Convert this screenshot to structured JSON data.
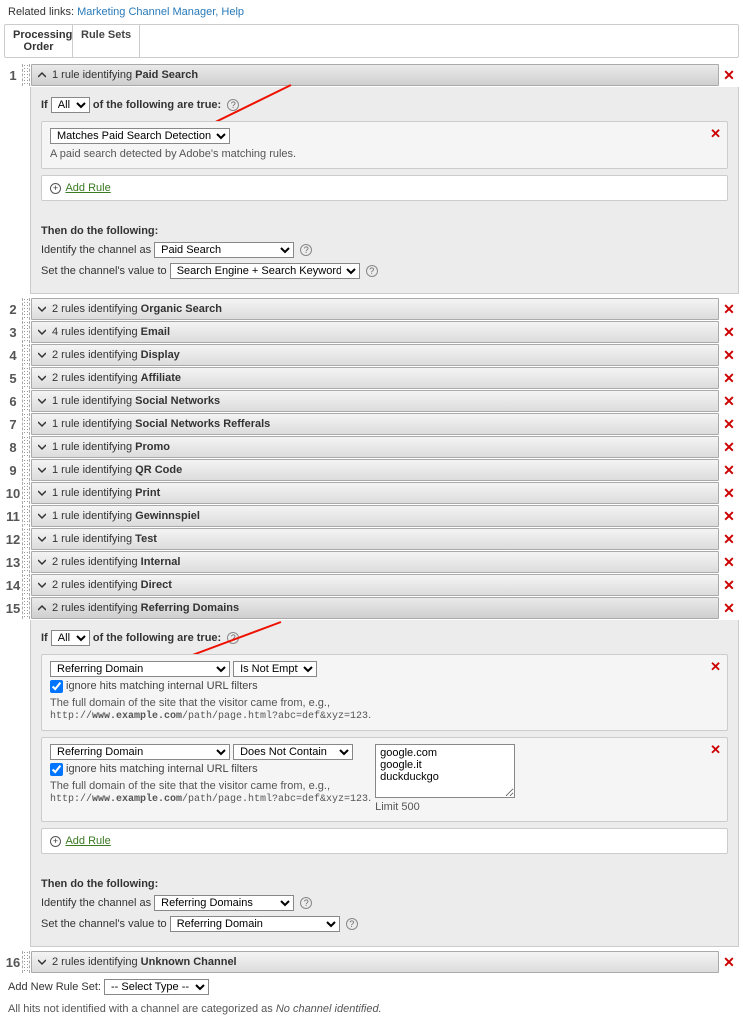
{
  "top": {
    "related_label": "Related links:",
    "link1": "Marketing Channel Manager,",
    "link2": "Help"
  },
  "tabs": {
    "processing": "Processing Order",
    "rule_sets": "Rule Sets"
  },
  "rules": {
    "r1": {
      "num": "1",
      "count": "1 rule identifying ",
      "name": "Paid Search"
    },
    "r2": {
      "num": "2",
      "count": "2 rules identifying ",
      "name": "Organic Search"
    },
    "r3": {
      "num": "3",
      "count": "4 rules identifying ",
      "name": "Email"
    },
    "r4": {
      "num": "4",
      "count": "2 rules identifying ",
      "name": "Display"
    },
    "r5": {
      "num": "5",
      "count": "2 rules identifying ",
      "name": "Affiliate"
    },
    "r6": {
      "num": "6",
      "count": "1 rule identifying ",
      "name": "Social Networks"
    },
    "r7": {
      "num": "7",
      "count": "1 rule identifying ",
      "name": "Social Networks Refferals"
    },
    "r8": {
      "num": "8",
      "count": "1 rule identifying ",
      "name": "Promo"
    },
    "r9": {
      "num": "9",
      "count": "1 rule identifying ",
      "name": "QR Code"
    },
    "r10": {
      "num": "10",
      "count": "1 rule identifying ",
      "name": "Print"
    },
    "r11": {
      "num": "11",
      "count": "1 rule identifying ",
      "name": "Gewinnspiel"
    },
    "r12": {
      "num": "12",
      "count": "1 rule identifying ",
      "name": "Test"
    },
    "r13": {
      "num": "13",
      "count": "2 rules identifying ",
      "name": "Internal"
    },
    "r14": {
      "num": "14",
      "count": "2 rules identifying ",
      "name": "Direct"
    },
    "r15": {
      "num": "15",
      "count": "2 rules identifying ",
      "name": "Referring Domains"
    },
    "r16": {
      "num": "16",
      "count": "2 rules identifying ",
      "name": "Unknown Channel"
    }
  },
  "body1": {
    "if_prefix": "If",
    "if_suffix": "of the following are true:",
    "all_opt": "All",
    "cond_select": "Matches Paid Search Detection Rules",
    "cond_desc": "A paid search detected by Adobe's matching rules.",
    "add_rule": "Add Rule",
    "then_label": "Then do the following:",
    "identify_label": "Identify the channel as",
    "identify_val": "Paid Search",
    "setval_label": "Set the channel's value to",
    "setval_val": "Search Engine + Search Keyword(s)"
  },
  "body15": {
    "if_prefix": "If",
    "if_suffix": "of the following are true:",
    "all_opt": "All",
    "domain_sel": "Referring Domain",
    "cond1_op": "Is Not Empty",
    "cond2_op": "Does Not Contain",
    "ignore_label": "ignore hits matching internal URL filters",
    "desc_line": "The full domain of the site that the visitor came from, e.g.,",
    "desc_code_a": "http://",
    "desc_code_b": "www.example.com",
    "desc_code_c": "/path/page.html?abc=def&xyz=123",
    "limit_label": "Limit 500",
    "textarea": "google.com\ngoogle.it\nduckduckgo",
    "add_rule": "Add Rule",
    "then_label": "Then do the following:",
    "identify_label": "Identify the channel as",
    "identify_val": "Referring Domains",
    "setval_label": "Set the channel's value to",
    "setval_val": "Referring Domain"
  },
  "addnew": {
    "label": "Add New Rule Set:",
    "opt": "-- Select Type --"
  },
  "footer": {
    "text": "All hits not identified with a channel are categorized as ",
    "italic": "No channel identified."
  }
}
